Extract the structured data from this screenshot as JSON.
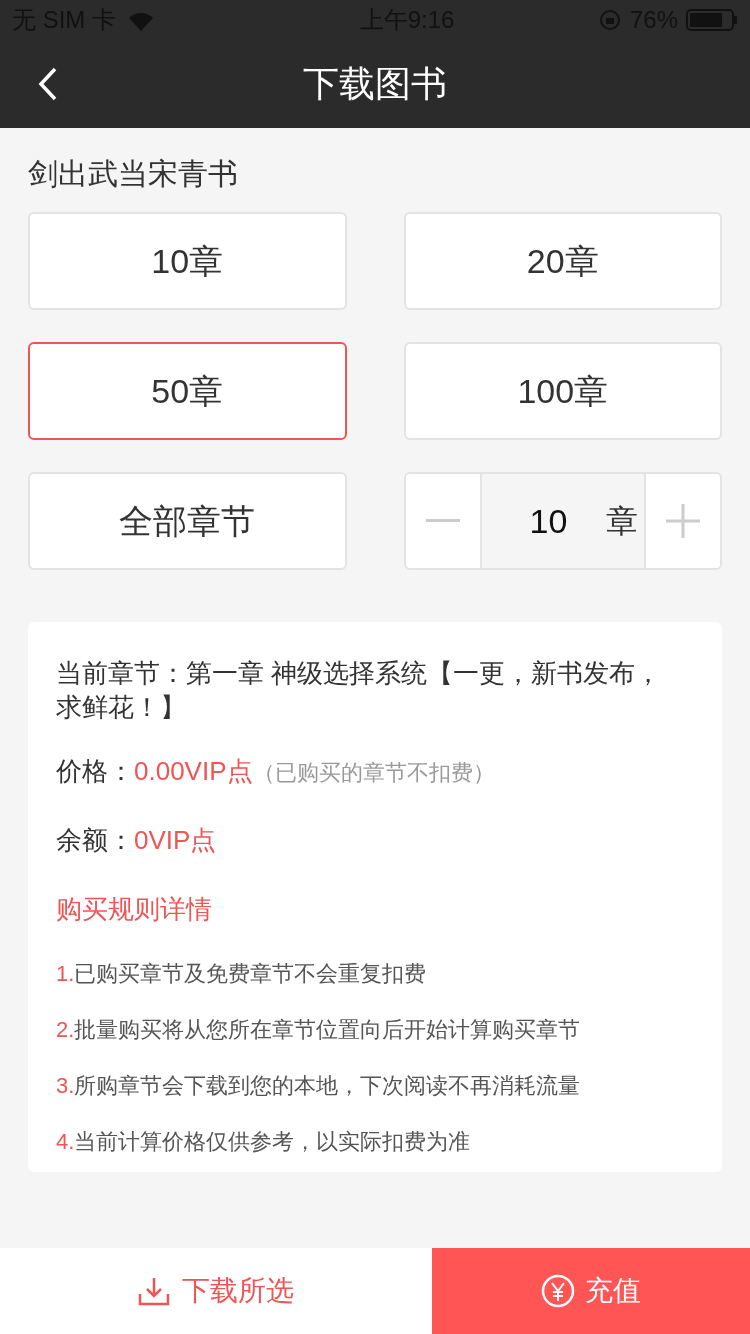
{
  "status_bar": {
    "carrier": "无 SIM 卡",
    "time": "上午9:16",
    "battery": "76%"
  },
  "nav": {
    "title": "下载图书"
  },
  "book_title": "剑出武当宋青书",
  "options": [
    {
      "label": "10章",
      "selected": false
    },
    {
      "label": "20章",
      "selected": false
    },
    {
      "label": "50章",
      "selected": true
    },
    {
      "label": "100章",
      "selected": false
    },
    {
      "label": "全部章节",
      "selected": false
    }
  ],
  "stepper": {
    "value": "10",
    "unit": "章"
  },
  "info": {
    "current_chapter": "当前章节：第一章 神级选择系统【一更，新书发布，求鲜花！】",
    "price_label": "价格：",
    "price_value": "0.00VIP点",
    "price_note": "（已购买的章节不扣费）",
    "balance_label": "余额：",
    "balance_value": "0VIP点",
    "rules_link": "购买规则详情",
    "rules": [
      {
        "number": "1.",
        "text": "已购买章节及免费章节不会重复扣费"
      },
      {
        "number": "2.",
        "text": "批量购买将从您所在章节位置向后开始计算购买章节"
      },
      {
        "number": "3.",
        "text": "所购章节会下载到您的本地，下次阅读不再消耗流量"
      },
      {
        "number": "4.",
        "text": "当前计算价格仅供参考，以实际扣费为准"
      }
    ]
  },
  "bottom": {
    "download": "下载所选",
    "recharge": "充值"
  }
}
